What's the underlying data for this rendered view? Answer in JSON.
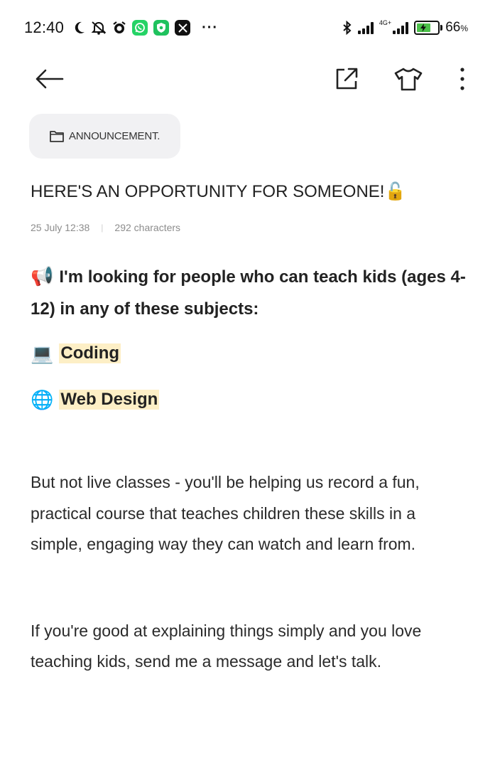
{
  "status_bar": {
    "time": "12:40",
    "network_label": "4G+",
    "battery_percent": "66",
    "battery_unit": "%",
    "battery_level": 0.66,
    "charging": true,
    "app_icons": [
      "moon-icon",
      "mute-icon",
      "alarm-icon",
      "whatsapp-icon",
      "shield-app-icon",
      "x-app-icon"
    ],
    "more_indicator": "···",
    "colors": {
      "whatsapp": "#25d366",
      "shield_app": "#1fc25e",
      "x_app": "#111111",
      "battery_fill": "#4cc04a"
    }
  },
  "toolbar": {
    "icons": [
      "back-arrow-icon",
      "share-export-icon",
      "theme-shirt-icon",
      "more-vertical-icon"
    ]
  },
  "note": {
    "folder": "ANNOUNCEMENT.",
    "title": "HERE'S AN OPPORTUNITY FOR SOMEONE!",
    "title_emoji": "🔓",
    "date": "25 July 12:38",
    "meta_separator": "|",
    "characters": "292 characters",
    "intro_emoji": "📢",
    "intro": "I'm looking for people who can teach kids (ages 4-12) in any of these subjects:",
    "subjects": [
      {
        "emoji": "💻",
        "label": "Coding"
      },
      {
        "emoji": "🌐",
        "label": "Web Design"
      }
    ],
    "paragraph_1": "But not live classes - you'll be helping us record a fun, practical course that teaches children these skills in a simple, engaging way they can watch and learn from.",
    "paragraph_2": "If you're good at explaining things simply and you love teaching kids, send me a message and let's talk.",
    "highlight_color": "#fdefc6"
  }
}
